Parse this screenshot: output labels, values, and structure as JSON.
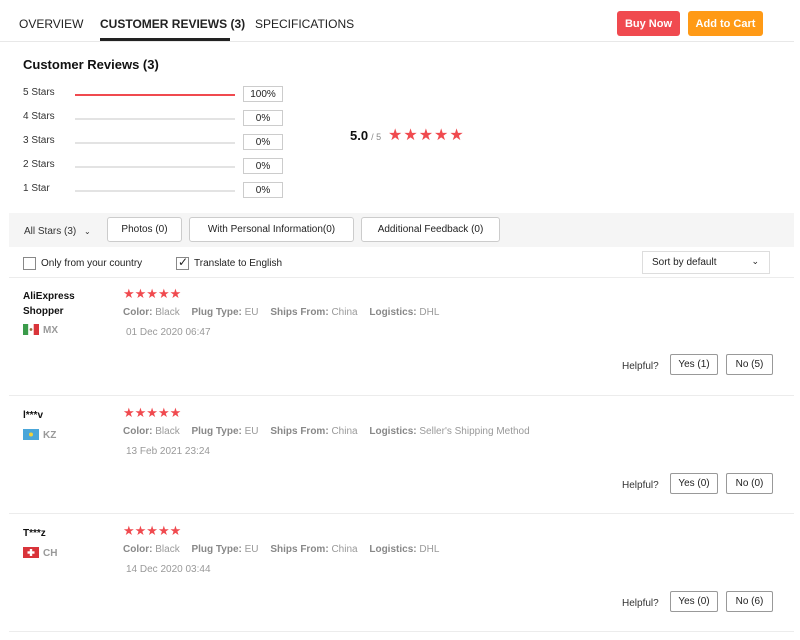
{
  "nav": {
    "tabs": [
      "OVERVIEW",
      "CUSTOMER REVIEWS (3)",
      "SPECIFICATIONS"
    ],
    "buy_now": "Buy Now",
    "add_to_cart": "Add to Cart"
  },
  "summary": {
    "title": "Customer Reviews (3)",
    "histogram": [
      {
        "label": "5 Stars",
        "pct": "100%",
        "fraction": 1.0
      },
      {
        "label": "4 Stars",
        "pct": "0%",
        "fraction": 0
      },
      {
        "label": "3 Stars",
        "pct": "0%",
        "fraction": 0
      },
      {
        "label": "2 Stars",
        "pct": "0%",
        "fraction": 0
      },
      {
        "label": "1 Star",
        "pct": "0%",
        "fraction": 0
      }
    ],
    "score": "5.0",
    "score_max": "/ 5",
    "stars": "★★★★★"
  },
  "filters": {
    "all_stars": "All Stars (3)",
    "photos": "Photos (0)",
    "personal": "With Personal Information(0)",
    "additional": "Additional Feedback (0)",
    "only_country": "Only from your country",
    "translate": "Translate to English",
    "sort": "Sort by default"
  },
  "reviews": [
    {
      "name": "AliExpress Shopper",
      "country": "MX",
      "stars": "★★★★★",
      "color_label": "Color:",
      "color": "Black",
      "plug_label": "Plug Type:",
      "plug": "EU",
      "ships_label": "Ships From:",
      "ships": "China",
      "logistics_label": "Logistics:",
      "logistics": "DHL",
      "date": "01 Dec 2020 06:47",
      "helpful": "Helpful?",
      "yes": "Yes (1)",
      "no": "No (5)"
    },
    {
      "name": "l***v",
      "country": "KZ",
      "stars": "★★★★★",
      "color_label": "Color:",
      "color": "Black",
      "plug_label": "Plug Type:",
      "plug": "EU",
      "ships_label": "Ships From:",
      "ships": "China",
      "logistics_label": "Logistics:",
      "logistics": "Seller's Shipping Method",
      "date": "13 Feb 2021 23:24",
      "helpful": "Helpful?",
      "yes": "Yes (0)",
      "no": "No (0)"
    },
    {
      "name": "T***z",
      "country": "CH",
      "stars": "★★★★★",
      "color_label": "Color:",
      "color": "Black",
      "plug_label": "Plug Type:",
      "plug": "EU",
      "ships_label": "Ships From:",
      "ships": "China",
      "logistics_label": "Logistics:",
      "logistics": "DHL",
      "date": "14 Dec 2020 03:44",
      "helpful": "Helpful?",
      "yes": "Yes (0)",
      "no": "No (6)"
    }
  ],
  "colors": {
    "accent_red": "#f04a4f",
    "accent_orange": "#ff9a16"
  },
  "icons": {
    "chevron": "chevron-down-icon",
    "check": "check-icon",
    "star": "star-icon",
    "flag": "flag-icon"
  }
}
